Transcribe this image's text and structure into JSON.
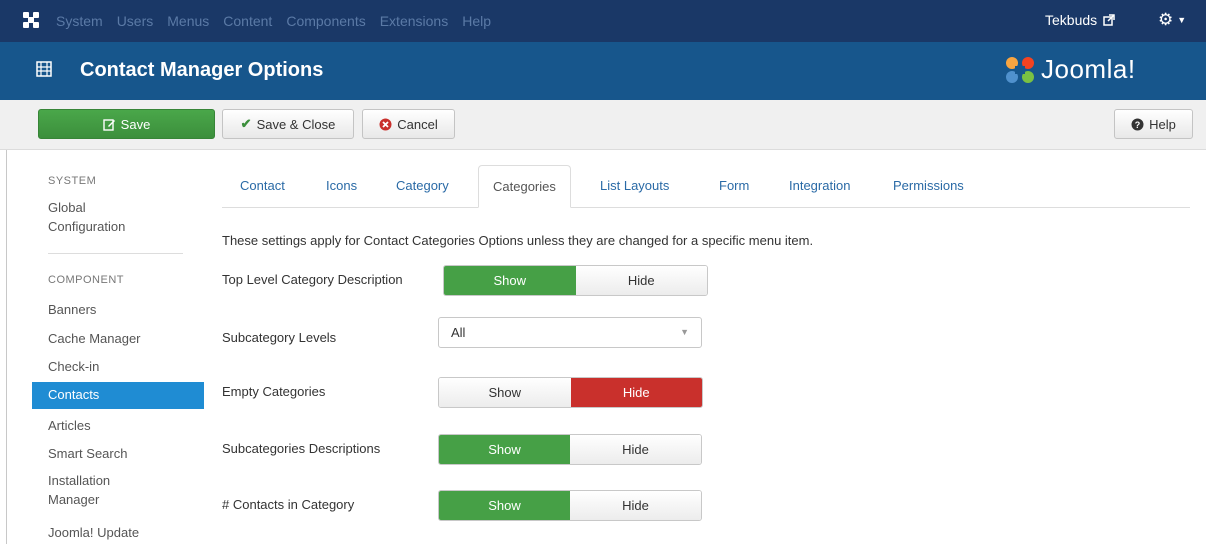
{
  "navbar": {
    "menu": [
      "System",
      "Users",
      "Menus",
      "Content",
      "Components",
      "Extensions",
      "Help"
    ],
    "user": "Tekbuds",
    "user_icon": "external-link-icon",
    "settings_icon": "gear-icon"
  },
  "titlebar": {
    "title": "Contact Manager Options",
    "brand": "Joomla!"
  },
  "toolbar": {
    "save_label": "Save",
    "save_close_label": "Save & Close",
    "cancel_label": "Cancel",
    "help_label": "Help"
  },
  "sidebar": {
    "system_heading": "SYSTEM",
    "global_config": [
      "Global",
      "Configuration"
    ],
    "component_heading": "COMPONENT",
    "items": [
      "Banners",
      "Cache Manager",
      "Check-in",
      "Contacts",
      "Articles",
      "Smart Search",
      "Installation",
      "Manager",
      "Joomla! Update"
    ],
    "active_item": "Contacts"
  },
  "tabs": [
    "Contact",
    "Icons",
    "Category",
    "Categories",
    "List Layouts",
    "Form",
    "Integration",
    "Permissions"
  ],
  "active_tab": "Categories",
  "intro": "These settings apply for Contact Categories Options unless they are changed for a specific menu item.",
  "fields": {
    "top_level_desc": {
      "label": "Top Level Category Description",
      "options": [
        "Show",
        "Hide"
      ],
      "selected": "Show"
    },
    "subcat_levels": {
      "label": "Subcategory Levels",
      "value": "All"
    },
    "empty_categories": {
      "label": "Empty Categories",
      "options": [
        "Show",
        "Hide"
      ],
      "selected": "Hide"
    },
    "subcat_desc": {
      "label": "Subcategories Descriptions",
      "options": [
        "Show",
        "Hide"
      ],
      "selected": "Show"
    },
    "contacts_in_cat": {
      "label": "# Contacts in Category",
      "options": [
        "Show",
        "Hide"
      ],
      "selected": "Show"
    }
  },
  "colors": {
    "navbar": "#1a3867",
    "titlebar": "#17568c",
    "green": "#46a046",
    "red": "#c9302c",
    "active_sidebar": "#1f8cd3"
  }
}
